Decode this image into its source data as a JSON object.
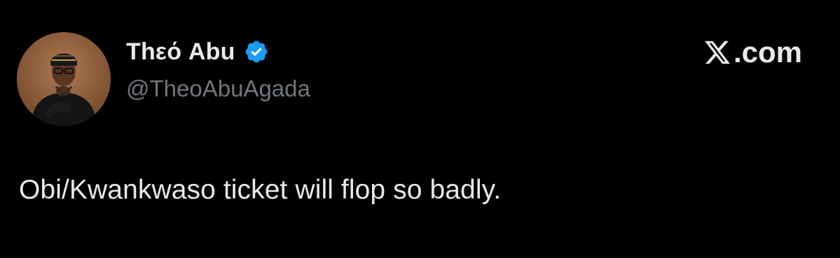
{
  "tweet": {
    "author": {
      "display_name": "Thεό Abu",
      "handle": "@TheoAbuAgada",
      "verified": true,
      "verified_color": "#1d9bf0",
      "avatar_icon": "avatar"
    },
    "site": {
      "domain": ".com",
      "logo_icon": "x-logo-icon"
    },
    "text": "Obi/Kwankwaso ticket will flop so badly."
  },
  "colors": {
    "background": "#000000",
    "primary_text": "#e7e9ea",
    "secondary_text": "#71767b",
    "accent": "#1d9bf0"
  }
}
